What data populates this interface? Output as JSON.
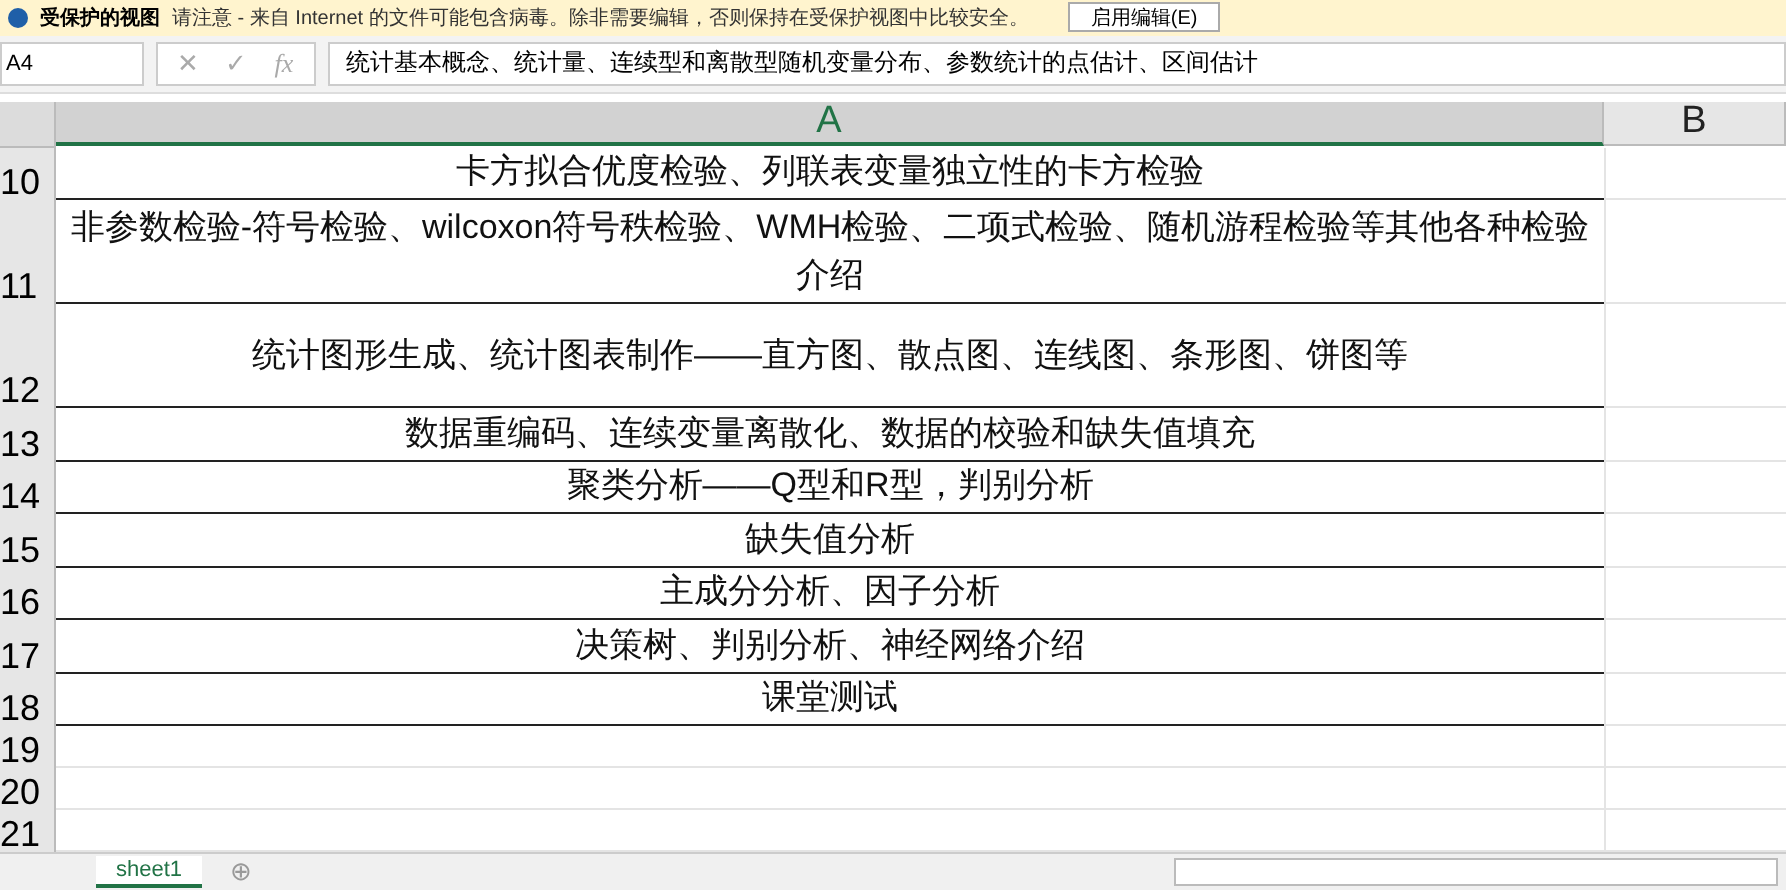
{
  "message_bar": {
    "title": "受保护的视图",
    "text": "请注意 - 来自 Internet 的文件可能包含病毒。除非需要编辑，否则保持在受保护视图中比较安全。",
    "button": "启用编辑(E)"
  },
  "formula_bar": {
    "name_box": "A4",
    "cancel": "✕",
    "enter": "✓",
    "fx": "fx",
    "value": "统计基本概念、统计量、连续型和离散型随机变量分布、参数统计的点估计、区间估计"
  },
  "columns": [
    {
      "label": "A",
      "selected": true
    },
    {
      "label": "B",
      "selected": false
    }
  ],
  "rows": [
    {
      "number": "10",
      "text": "卡方拟合优度检验、列联表变量独立性的卡方检验",
      "tall": false
    },
    {
      "number": "11",
      "text": "非参数检验-符号检验、wilcoxon符号秩检验、WMH检验、二项式检验、随机游程检验等其他各种检验介绍",
      "tall": true
    },
    {
      "number": "12",
      "text": "统计图形生成、统计图表制作——直方图、散点图、连线图、条形图、饼图等",
      "tall": true
    },
    {
      "number": "13",
      "text": "数据重编码、连续变量离散化、数据的校验和缺失值填充",
      "tall": false
    },
    {
      "number": "14",
      "text": "聚类分析——Q型和R型，判别分析",
      "tall": false
    },
    {
      "number": "15",
      "text": "缺失值分析",
      "tall": false
    },
    {
      "number": "16",
      "text": "主成分分析、因子分析",
      "tall": false
    },
    {
      "number": "17",
      "text": "决策树、判别分析、神经网络介绍",
      "tall": false
    },
    {
      "number": "18",
      "text": "课堂测试",
      "tall": false
    },
    {
      "number": "19",
      "text": "",
      "tall": false
    },
    {
      "number": "20",
      "text": "",
      "tall": false
    },
    {
      "number": "21",
      "text": "",
      "tall": false
    }
  ],
  "sheets": [
    {
      "label": "sheet1",
      "selected": true
    }
  ],
  "add_sheet": "⊕"
}
